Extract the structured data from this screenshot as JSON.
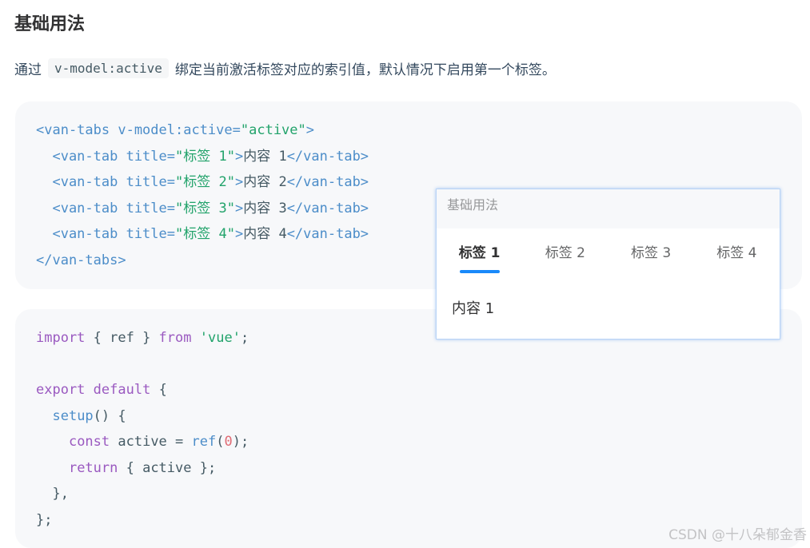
{
  "section": {
    "title": "基础用法",
    "desc_before": "通过",
    "desc_code": "v-model:active",
    "desc_after": "绑定当前激活标签对应的索引值，默认情况下启用第一个标签。"
  },
  "code1": {
    "l1": {
      "a": "<van-tabs v-model:active=",
      "b": "\"active\"",
      "c": ">"
    },
    "l2": {
      "a": "  <van-tab title=",
      "b": "\"标签 1\"",
      "c": ">",
      "d": "内容 1",
      "e": "</van-tab>"
    },
    "l3": {
      "a": "  <van-tab title=",
      "b": "\"标签 2\"",
      "c": ">",
      "d": "内容 2",
      "e": "</van-tab>"
    },
    "l4": {
      "a": "  <van-tab title=",
      "b": "\"标签 3\"",
      "c": ">",
      "d": "内容 3",
      "e": "</van-tab>"
    },
    "l5": {
      "a": "  <van-tab title=",
      "b": "\"标签 4\"",
      "c": ">",
      "d": "内容 4",
      "e": "</van-tab>"
    },
    "l6": {
      "a": "</van-tabs>"
    }
  },
  "code2": {
    "l1": {
      "a": "import",
      "b": " { ref } ",
      "c": "from",
      "d": " ",
      "e": "'vue'",
      "f": ";"
    },
    "l3": {
      "a": "export",
      "b": " ",
      "c": "default",
      "d": " {"
    },
    "l4": {
      "a": "  ",
      "b": "setup",
      "c": "() {"
    },
    "l5": {
      "a": "    ",
      "b": "const",
      "c": " active = ",
      "d": "ref",
      "e": "(",
      "f": "0",
      "g": ");"
    },
    "l6": {
      "a": "    ",
      "b": "return",
      "c": " { active };"
    },
    "l7": {
      "a": "  },"
    },
    "l8": {
      "a": "};"
    }
  },
  "preview": {
    "header": "基础用法",
    "tabs": [
      "标签 1",
      "标签 2",
      "标签 3",
      "标签 4"
    ],
    "active_index": 0,
    "content": "内容 1",
    "accent_color": "#1989fa"
  },
  "watermark": "CSDN @十八朵郁金香"
}
